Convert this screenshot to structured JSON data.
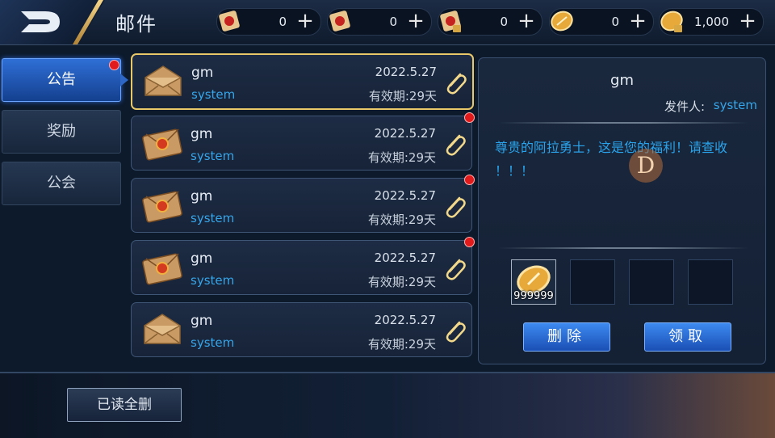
{
  "header": {
    "title": "邮件"
  },
  "currencies": [
    {
      "icon": "red-scroll-icon",
      "value": "0"
    },
    {
      "icon": "red-scroll-icon",
      "value": "0"
    },
    {
      "icon": "locked-scroll-icon",
      "value": "0"
    },
    {
      "icon": "gold-coin-icon",
      "value": "0"
    },
    {
      "icon": "locked-coin-icon",
      "value": "1,000"
    }
  ],
  "tabs": [
    {
      "label": "公告",
      "active": true
    },
    {
      "label": "奖励",
      "active": false
    },
    {
      "label": "公会",
      "active": false
    }
  ],
  "mails": [
    {
      "sender": "gm",
      "sub": "system",
      "date": "2022.5.27",
      "expiry": "有效期:29天",
      "selected": true,
      "unread": false,
      "opened": true
    },
    {
      "sender": "gm",
      "sub": "system",
      "date": "2022.5.27",
      "expiry": "有效期:29天",
      "selected": false,
      "unread": true,
      "opened": false
    },
    {
      "sender": "gm",
      "sub": "system",
      "date": "2022.5.27",
      "expiry": "有效期:29天",
      "selected": false,
      "unread": true,
      "opened": false
    },
    {
      "sender": "gm",
      "sub": "system",
      "date": "2022.5.27",
      "expiry": "有效期:29天",
      "selected": false,
      "unread": true,
      "opened": false
    },
    {
      "sender": "gm",
      "sub": "system",
      "date": "2022.5.27",
      "expiry": "有效期:29天",
      "selected": false,
      "unread": false,
      "opened": true
    }
  ],
  "detail": {
    "sender": "gm",
    "from_label": "发件人:",
    "from_value": "system",
    "body_line1": "尊贵的阿拉勇士，这是您的福利！请查收",
    "body_line2": "！！！",
    "watermark": "D",
    "attachment_qty": "999999",
    "delete_label": "删除",
    "claim_label": "领取"
  },
  "footer": {
    "read_all_label": "已读全删"
  },
  "colors": {
    "accent_blue": "#2f6fd6",
    "link_blue": "#36a6ea",
    "gold_border": "#e9c869",
    "unread_dot": "#e11b1b"
  }
}
